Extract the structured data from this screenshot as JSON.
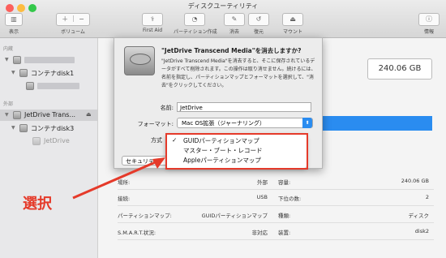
{
  "window": {
    "title": "ディスクユーティリティ"
  },
  "toolbar": {
    "view_label": "表示",
    "volume_label": "ボリューム",
    "firstaid_label": "First Aid",
    "partition_label": "パーティション作成",
    "erase_label": "消去",
    "restore_label": "復元",
    "mount_label": "マウント",
    "info_label": "情報"
  },
  "sidebar": {
    "internal_header": "内蔵",
    "external_header": "外部",
    "items": [
      {
        "label": "コンテナdisk1"
      },
      {
        "label": "JetDrive Trans..."
      },
      {
        "label": "コンテナdisk3"
      },
      {
        "label": "JetDrive"
      }
    ]
  },
  "main": {
    "capacity": "240.06 GB"
  },
  "info_table": {
    "rows": [
      {
        "l1": "場所:",
        "v1": "外部",
        "l2": "容量:",
        "v2": "240.06 GB"
      },
      {
        "l1": "接続:",
        "v1": "USB",
        "l2": "下位の数:",
        "v2": "2"
      },
      {
        "l1": "パーティションマップ:",
        "v1": "GUIDパーティションマップ",
        "l2": "種類:",
        "v2": "ディスク"
      },
      {
        "l1": "S.M.A.R.T.状況:",
        "v1": "非対応",
        "l2": "装置:",
        "v2": "disk2"
      }
    ]
  },
  "dialog": {
    "title": "\"JetDrive Transcend Media\"を消去しますか?",
    "body": "\"JetDrive Transcend Media\"を消去すると、そこに保存されているデータがすべて削除されます。この操作は取り消せません。続けるには、名前を指定し、パーティションマップとフォーマットを選択して、\"消去\"をクリックしてください。",
    "name_label": "名前:",
    "name_value": "JetDrive",
    "format_label": "フォーマット:",
    "format_value": "Mac OS拡張（ジャーナリング）",
    "scheme_label": "方式",
    "security_label": "セキュリティ"
  },
  "dropdown": {
    "items": [
      {
        "label": "GUIDパーティションマップ",
        "checked": true
      },
      {
        "label": "マスター・ブート・レコード",
        "checked": false
      },
      {
        "label": "Appleパーティションマップ",
        "checked": false
      }
    ],
    "checkmark": "✓"
  },
  "annotation": {
    "text": "選択"
  },
  "colors": {
    "accent": "#2a8cf0",
    "annotation": "#e53a2a"
  }
}
